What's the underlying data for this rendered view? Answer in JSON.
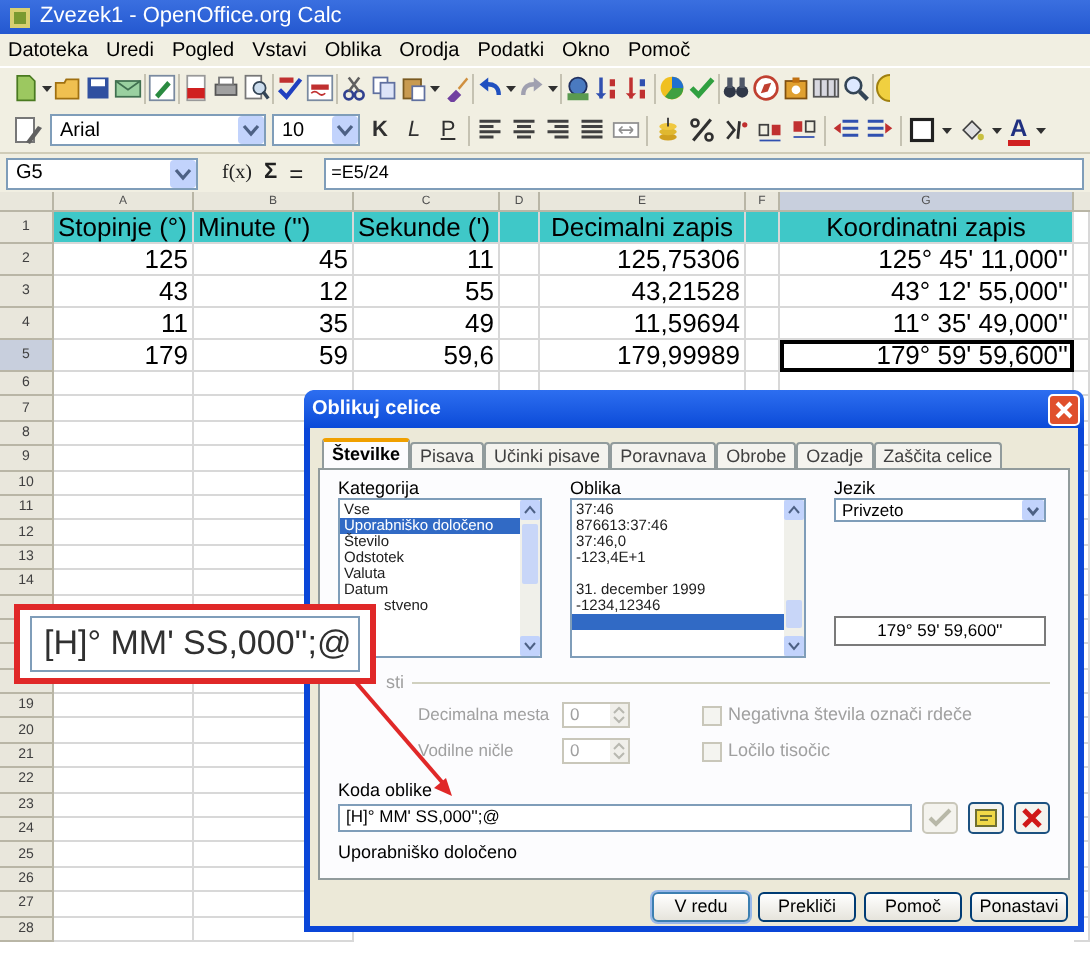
{
  "window": {
    "title": "Zvezek1 - OpenOffice.org Calc"
  },
  "menu": [
    "Datoteka",
    "Uredi",
    "Pogled",
    "Vstavi",
    "Oblika",
    "Orodja",
    "Podatki",
    "Okno",
    "Pomoč"
  ],
  "format_toolbar": {
    "font": "Arial",
    "size": "10",
    "style_buttons": [
      "K",
      "L",
      "P"
    ],
    "font_color": "A"
  },
  "formula_bar": {
    "cell_reference": "G5",
    "function_wizard": "f(x)",
    "sum": "Σ",
    "equals": "=",
    "formula": "=E5/24"
  },
  "sheet": {
    "columns": [
      {
        "label": "A",
        "selected": false
      },
      {
        "label": "B",
        "selected": false
      },
      {
        "label": "C",
        "selected": false
      },
      {
        "label": "D",
        "selected": false
      },
      {
        "label": "E",
        "selected": false
      },
      {
        "label": "F",
        "selected": false
      },
      {
        "label": "G",
        "selected": true
      }
    ],
    "rows": [
      {
        "header": "1",
        "kind": "heading",
        "selected": false,
        "cells": [
          {
            "text": "Stopinje (°)",
            "selected": false
          },
          {
            "text": "Minute ('')",
            "selected": false
          },
          {
            "text": "Sekunde (')",
            "selected": false
          },
          {
            "selected": false
          },
          {
            "text": "Decimalni zapis",
            "selected": false
          },
          {
            "selected": false
          },
          {
            "text": "Koordinatni zapis",
            "selected": false
          }
        ]
      },
      {
        "header": "2",
        "kind": "data",
        "selected": false,
        "cells": [
          {
            "text": "125",
            "selected": false
          },
          {
            "text": "45",
            "selected": false
          },
          {
            "text": "11",
            "selected": false
          },
          {
            "selected": false
          },
          {
            "text": "125,75306",
            "selected": false
          },
          {
            "selected": false
          },
          {
            "text": "125° 45' 11,000''",
            "selected": false
          }
        ]
      },
      {
        "header": "3",
        "kind": "data",
        "selected": false,
        "cells": [
          {
            "text": "43",
            "selected": false
          },
          {
            "text": "12",
            "selected": false
          },
          {
            "text": "55",
            "selected": false
          },
          {
            "selected": false
          },
          {
            "text": "43,21528",
            "selected": false
          },
          {
            "selected": false
          },
          {
            "text": "43° 12' 55,000''",
            "selected": false
          }
        ]
      },
      {
        "header": "4",
        "kind": "data",
        "selected": false,
        "cells": [
          {
            "text": "11",
            "selected": false
          },
          {
            "text": "35",
            "selected": false
          },
          {
            "text": "49",
            "selected": false
          },
          {
            "selected": false
          },
          {
            "text": "11,59694",
            "selected": false
          },
          {
            "selected": false
          },
          {
            "text": "11° 35' 49,000''",
            "selected": false
          }
        ]
      },
      {
        "header": "5",
        "kind": "data",
        "selected": true,
        "cells": [
          {
            "text": "179",
            "selected": false
          },
          {
            "text": "59",
            "selected": false
          },
          {
            "text": "59,6",
            "selected": false
          },
          {
            "selected": false
          },
          {
            "text": "179,99989",
            "selected": false
          },
          {
            "selected": false
          },
          {
            "text": "179° 59' 59,600''",
            "selected": true
          }
        ]
      },
      {
        "header": "6",
        "kind": "empty",
        "selected": false
      },
      {
        "header": "7",
        "kind": "empty",
        "selected": false
      },
      {
        "header": "8",
        "kind": "empty",
        "selected": false
      },
      {
        "header": "9",
        "kind": "empty",
        "selected": false
      },
      {
        "header": "10",
        "kind": "empty",
        "selected": false
      },
      {
        "header": "11",
        "kind": "empty",
        "selected": false
      },
      {
        "header": "12",
        "kind": "empty",
        "selected": false
      },
      {
        "header": "13",
        "kind": "empty",
        "selected": false
      },
      {
        "header": "14",
        "kind": "empty",
        "selected": false
      },
      {
        "kind": "empty",
        "selected": false
      },
      {
        "kind": "empty",
        "selected": false
      },
      {
        "kind": "empty",
        "selected": false
      },
      {
        "kind": "empty",
        "selected": false
      },
      {
        "header": "19",
        "kind": "empty",
        "selected": false
      },
      {
        "header": "20",
        "kind": "empty",
        "selected": false
      },
      {
        "header": "21",
        "kind": "empty",
        "selected": false
      },
      {
        "header": "22",
        "kind": "empty",
        "selected": false
      },
      {
        "header": "23",
        "kind": "empty",
        "selected": false
      },
      {
        "header": "24",
        "kind": "empty",
        "selected": false
      },
      {
        "header": "25",
        "kind": "empty",
        "selected": false
      },
      {
        "header": "26",
        "kind": "empty",
        "selected": false
      },
      {
        "header": "27",
        "kind": "empty",
        "selected": false
      },
      {
        "header": "28",
        "kind": "empty",
        "selected": false
      }
    ]
  },
  "dialog": {
    "title": "Oblikuj celice",
    "tabs": [
      {
        "label": "Številke",
        "selected": true
      },
      {
        "label": "Pisava",
        "selected": false
      },
      {
        "label": "Učinki pisave",
        "selected": false
      },
      {
        "label": "Poravnava",
        "selected": false
      },
      {
        "label": "Obrobe",
        "selected": false
      },
      {
        "label": "Ozadje",
        "selected": false
      },
      {
        "label": "Zaščita celice",
        "selected": false
      }
    ],
    "category": {
      "label": "Kategorija",
      "items": [
        {
          "text": "Vse",
          "selected": false,
          "kind": "full"
        },
        {
          "text": "Uporabniško določeno",
          "selected": true,
          "kind": "full"
        },
        {
          "text": "Število",
          "selected": false,
          "kind": "full"
        },
        {
          "text": "Odstotek",
          "selected": false,
          "kind": "full"
        },
        {
          "text": "Valuta",
          "selected": false,
          "kind": "full"
        },
        {
          "text": "Datum",
          "selected": false,
          "kind": "full"
        },
        {
          "text": "stveno",
          "selected": false,
          "kind": "partial"
        }
      ]
    },
    "format": {
      "label": "Oblika",
      "items": [
        {
          "text": "37:46",
          "selected": false
        },
        {
          "text": "876613:37:46",
          "selected": false
        },
        {
          "text": "37:46,0",
          "selected": false
        },
        {
          "text": "-123,4E+1",
          "selected": false
        },
        {
          "selected": false
        },
        {
          "text": "31. december 1999",
          "selected": false
        },
        {
          "text": "-1234,12346",
          "selected": false
        },
        {
          "selected": true
        }
      ]
    },
    "language": {
      "label": "Jezik",
      "value": "Privzeto"
    },
    "preview": "179° 59' 59,600''",
    "options": {
      "label": "sti",
      "rows": [
        {
          "label": "Decimalna mesta",
          "value": "0",
          "disabled": true
        },
        {
          "label": "Vodilne ničle",
          "value": "0",
          "disabled": true
        }
      ],
      "checkboxes": [
        {
          "label": "Negativna števila označi rdeče",
          "checked": false,
          "disabled": true
        },
        {
          "label": "Ločilo tisočic",
          "checked": false,
          "disabled": true
        }
      ]
    },
    "format_code": {
      "label": "Koda oblike",
      "value": "[H]° MM' SS,000'';@",
      "accept_disabled": true,
      "description": "Uporabniško določeno"
    },
    "buttons": [
      "V redu",
      "Prekliči",
      "Pomoč",
      "Ponastavi"
    ]
  },
  "callout": {
    "text": "[H]° MM' SS,000'';@"
  }
}
